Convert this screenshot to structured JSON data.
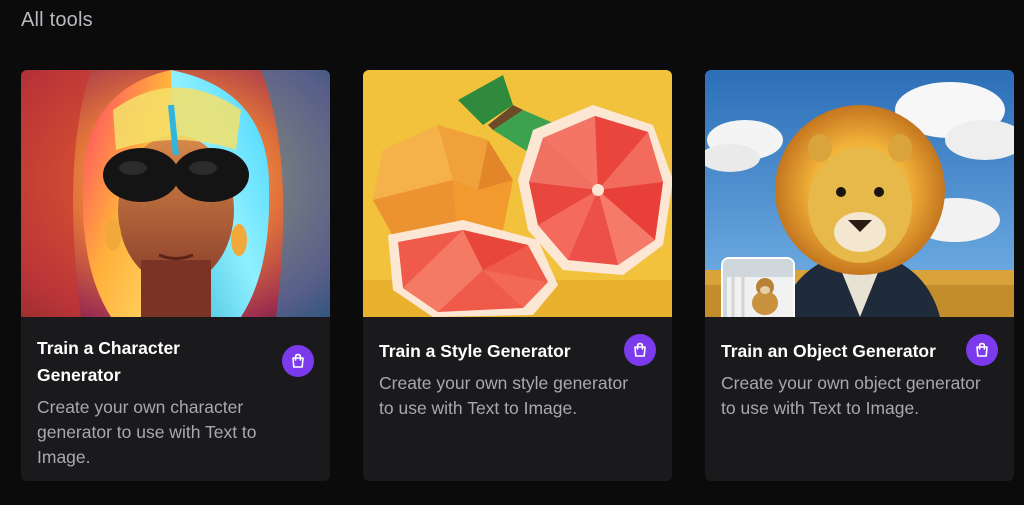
{
  "section": {
    "title": "All tools"
  },
  "cards": [
    {
      "title": "Train a Character Generator",
      "description": "Create your own character generator to use with Text to Image.",
      "image": "portrait-woman-sunglasses-colorful-hair",
      "badge_icon": "shopping-bag-icon"
    },
    {
      "title": "Train a Style Generator",
      "description": "Create your own style generator to use with Text to Image.",
      "image": "low-poly-oranges-grapefruit",
      "badge_icon": "shopping-bag-icon"
    },
    {
      "title": "Train an Object Generator",
      "description": "Create your own object generator to use with Text to Image.",
      "image": "knitted-lion-in-suit",
      "badge_icon": "shopping-bag-icon"
    }
  ],
  "colors": {
    "background": "#0b0b0c",
    "card": "#1a1a1c",
    "badge": "#7c3aed",
    "title": "#ffffff",
    "description": "#a8a8ae",
    "section_title": "#b9b9bf"
  }
}
